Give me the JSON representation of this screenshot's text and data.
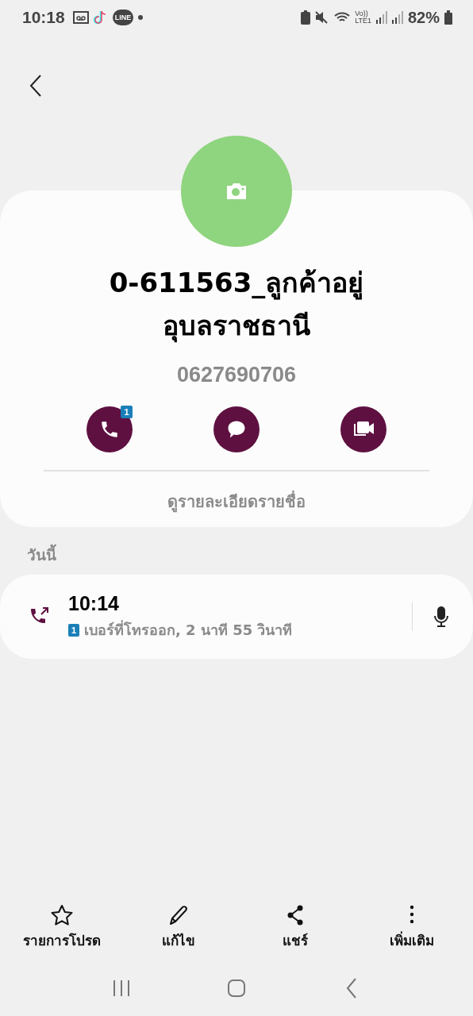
{
  "status_bar": {
    "time": "10:18",
    "line_logo": "LINE",
    "volte": "Vo))",
    "network": "LTE1",
    "battery": "82%"
  },
  "contact": {
    "name": "0-611563_ลูกค้าอยู่อุบลราชธานี",
    "phone": "0627690706",
    "details_link": "ดูรายละเอียดรายชื่อ"
  },
  "actions": [
    {
      "kind": "call",
      "badge": "1"
    },
    {
      "kind": "message"
    },
    {
      "kind": "video"
    }
  ],
  "history": {
    "heading": "วันนี้",
    "calls": [
      {
        "kind": "outgoing",
        "time": "10:14",
        "sim": "1",
        "description": "เบอร์ที่โทรออก, 2 นาที 55 วินาที"
      }
    ]
  },
  "bottom_bar": [
    {
      "kind": "favorite",
      "label": "รายการโปรด"
    },
    {
      "kind": "edit",
      "label": "แก้ไข"
    },
    {
      "kind": "share",
      "label": "แชร์"
    },
    {
      "kind": "more",
      "label": "เพิ่มเติม"
    }
  ]
}
